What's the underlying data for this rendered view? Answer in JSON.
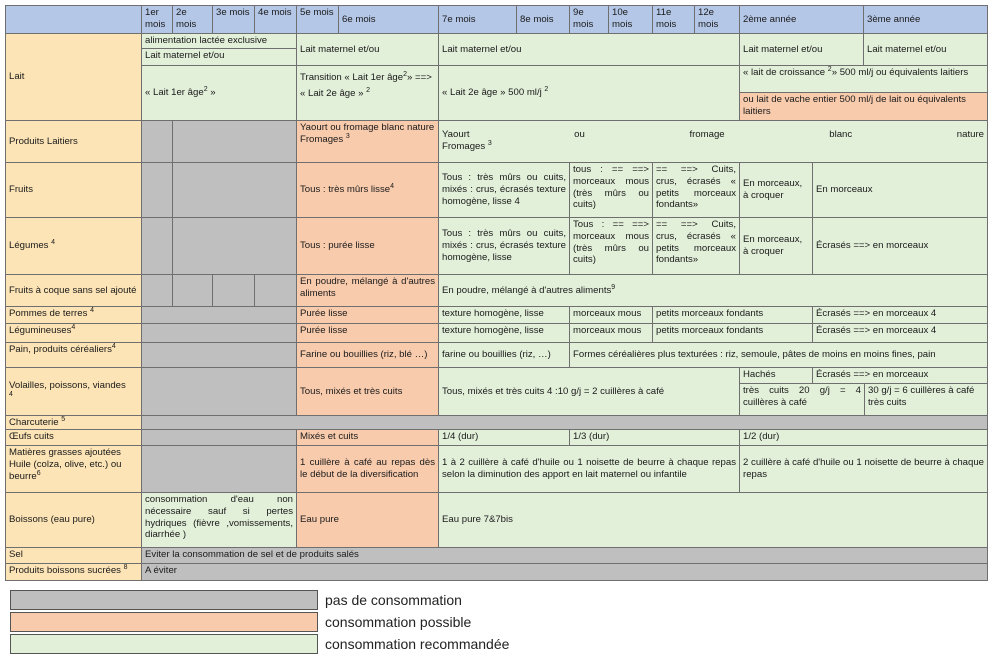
{
  "header": {
    "months": [
      "1er mois",
      "2e mois",
      "3e mois",
      "4e mois",
      "5e mois",
      "6e mois",
      "7e mois",
      "8e mois",
      "9e mois",
      "10e mois",
      "11e mois",
      "12e mois"
    ],
    "year2": "2ème année",
    "year3": "3ème année"
  },
  "rows": {
    "lait": {
      "label": "Lait",
      "excl": "alimentation lactée exclusive",
      "maternel": "Lait maternel et/ou",
      "lait1": "« Lait 1er âge",
      "lait1_sup": "2",
      "lait1_end": " »",
      "transition": "Transition « Lait 1er âge",
      "transition_sup": "2",
      "transition_end": "» ==>",
      "transition_b": "« Lait 2e âge »",
      "transition_b_sup": "2",
      "lait2": "« Lait 2e âge » 500 ml/j",
      "lait2_sup": "2",
      "croissance": "« lait de croissance",
      "croissance_sup": "2",
      "croissance_end": "» 500 ml/j ou équivalents laitiers",
      "vache": "ou lait de vache entier 500 ml/j de lait ou équivalents laitiers"
    },
    "produits_laitiers": {
      "label": "Produits Laitiers",
      "c1": "Yaourt ou fromage blanc nature",
      "c1_b": "Fromages",
      "c1_sup": "3",
      "c2": "Yaourt ou fromage blanc nature",
      "c2_b": "Fromages",
      "c2_sup": "3"
    },
    "fruits": {
      "label": "Fruits",
      "c1": "Tous : très mûrs lisse",
      "c1_sup": "4",
      "c2": "Tous : très mûrs ou cuits, mixés : crus, écrasés texture homogène, lisse 4",
      "c3": "tous : == ==> morceaux mous (très mûrs ou cuits)",
      "c4": "== ==> Cuits, crus, écrasés « petits morceaux fondants»",
      "c5": "En morceaux, à croquer",
      "c6": "En morceaux"
    },
    "legumes": {
      "label": "Légumes",
      "label_sup": "4",
      "c1": "Tous : purée lisse",
      "c2": "Tous : très mûrs ou cuits, mixés : crus, écrasés texture homogène, lisse",
      "c3": "Tous : == ==> morceaux mous (très mûrs ou cuits)",
      "c4": "== ==> Cuits, crus, écrasés « petits morceaux fondants»",
      "c5": "En morceaux, à croquer",
      "c6": "Écrasés ==> en morceaux"
    },
    "fruits_coque": {
      "label": "Fruits à coque sans sel ajouté",
      "c1": "En poudre, mélangé à d'autres aliments",
      "c2": "En poudre, mélangé à d'autres aliments",
      "c2_sup": "9"
    },
    "pommes_terre": {
      "label": "Pommes de terres",
      "label_sup": "4",
      "c1": "Purée lisse",
      "c2": "texture homogène, lisse",
      "c3": "morceaux mous",
      "c4": "petits morceaux fondants",
      "c5": "Écrasés ==> en morceaux 4"
    },
    "legumineuses": {
      "label": "Légumineuses",
      "label_sup": "4",
      "c1": "Purée lisse",
      "c2": "texture homogène, lisse",
      "c3": "morceaux mous",
      "c4": "petits morceaux fondants",
      "c5": "Écrasés ==> en morceaux 4"
    },
    "pain": {
      "label": "Pain, produits céréaliers",
      "label_sup": "4",
      "c1": "Farine ou bouillies (riz, blé …)",
      "c2": "farine ou bouillies (riz, …)",
      "c3": "Formes céréalières plus texturées : riz, semoule, pâtes de moins en moins fines, pain"
    },
    "volailles": {
      "label": "Volailles, poissons, viandes",
      "label_sup": "4",
      "c1": "Tous, mixés et très cuits",
      "c2": "Tous, mixés et très cuits 4 :10 g/j = 2 cuillères à café",
      "haches": "Hachés",
      "ecrases": "Écrasés ==> en morceaux",
      "c3": "très cuits 20 g/j = 4 cuillères à café",
      "c4": "30 g/j = 6 cuillères à café très cuits"
    },
    "charcuterie": {
      "label": "Charcuterie",
      "label_sup": "5"
    },
    "oeufs": {
      "label": "Œufs cuits",
      "c1": "Mixés et cuits",
      "c2": "1/4 (dur)",
      "c3": "1/3 (dur)",
      "c4": "1/2 (dur)"
    },
    "matieres_grasses": {
      "label": "Matières grasses ajoutées Huile (colza, olive, etc.) ou beurre",
      "label_sup": "6",
      "c1": "1 cuillère à café au repas dès le début de la diversification",
      "c2": "1 à 2 cuillère à café d'huile ou 1 noisette de beurre à chaque repas selon la diminution des apport en lait maternel ou infantile",
      "c3": "2 cuillère à café d'huile ou 1 noisette de beurre à chaque repas"
    },
    "boissons": {
      "label": "Boissons (eau pure)",
      "c0": "consommation d'eau non nécessaire sauf si pertes hydriques (fièvre ,vomissements, diarrhée )",
      "c1": "Eau pure",
      "c2": "Eau pure 7&7bis"
    },
    "sel": {
      "label": "Sel",
      "c1": "Eviter la consommation de sel et de produits salés"
    },
    "sucrees": {
      "label": "Produits boissons sucrées",
      "label_sup": "8",
      "c1": "A éviter"
    }
  },
  "legend": [
    {
      "label": "pas de consommation",
      "color": "#bfbfbf"
    },
    {
      "label": "consommation possible",
      "color": "#f8cbad"
    },
    {
      "label": "consommation recommandée",
      "color": "#e2efd9"
    }
  ],
  "colors": {
    "header": "#b4c7e7",
    "label_col": "#fce4b6",
    "none": "#bfbfbf",
    "possible": "#f8cbad",
    "recommended": "#e2efd9"
  }
}
